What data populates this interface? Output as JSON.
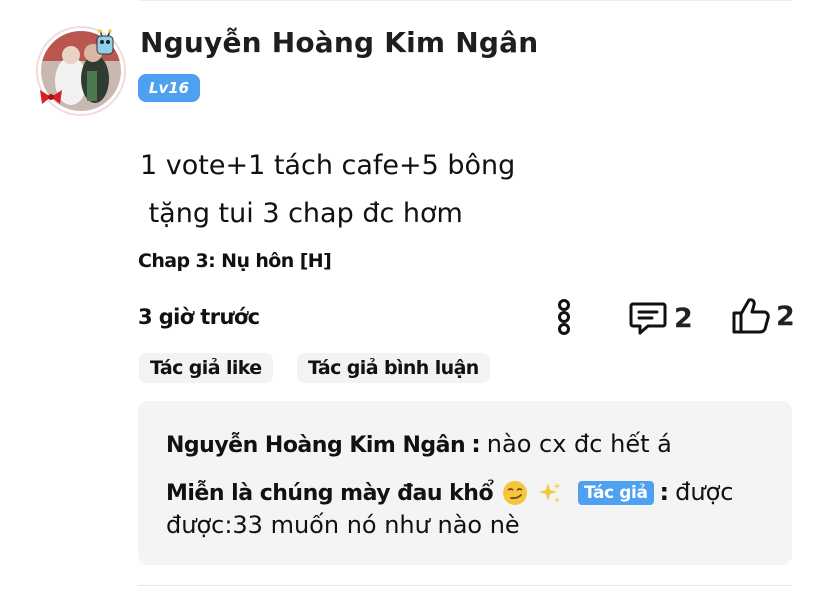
{
  "comment": {
    "author": "Nguyễn Hoàng Kim Ngân",
    "level": "Lv16",
    "content": "1 vote+1 tách cafe+5 bông\n tặng tui 3 chap đc hơm",
    "chapter": "Chap 3: Nụ hôn [H]",
    "time": "3 giờ trước",
    "reply_count": "2",
    "like_count": "2",
    "tags": [
      "Tác giả like",
      "Tác giả bình luận"
    ]
  },
  "replies": [
    {
      "author": "Nguyễn Hoàng Kim Ngân",
      "separator": ":",
      "text": "nào cx đc hết á"
    },
    {
      "author": "Miễn là chúng mày đau khổ",
      "badge": "Tác giả",
      "separator": ":",
      "text_line1": "được",
      "text_line2": "được:33 muốn nó như nào nè"
    }
  ],
  "icons": {
    "more": "more-vertical-icon",
    "comment": "comment-icon",
    "like": "thumbs-up-icon",
    "smirk": "smirk-emoji-icon",
    "sparkles": "sparkles-emoji-icon"
  },
  "colors": {
    "accent": "#4ea0f0",
    "reply_bg": "#f4f4f4",
    "tag_bg": "#f3f3f3"
  }
}
